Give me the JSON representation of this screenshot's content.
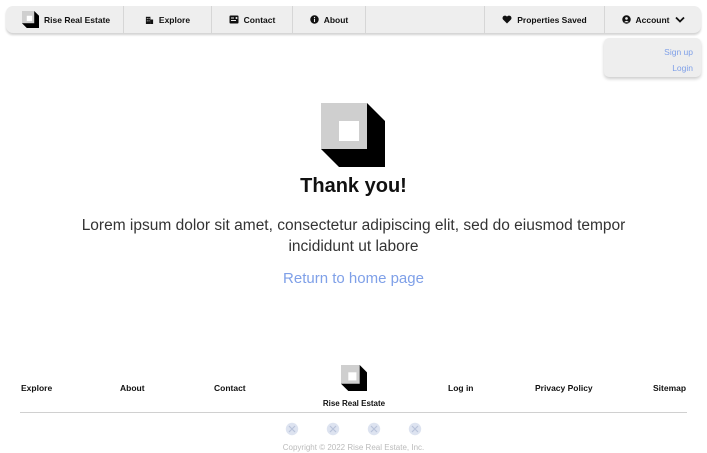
{
  "nav": {
    "brand": "Rise Real Estate",
    "explore": "Explore",
    "contact": "Contact",
    "about": "About",
    "saved": "Properties Saved",
    "account": "Account"
  },
  "dropdown": {
    "signup": "Sign up",
    "login": "Login"
  },
  "main": {
    "title": "Thank you!",
    "description": "Lorem ipsum dolor sit amet, consectetur adipiscing elit, sed do eiusmod tempor incididunt ut labore",
    "home_link": "Return to home page"
  },
  "footer": {
    "explore": "Explore",
    "about": "About",
    "contact": "Contact",
    "brand": "Rise Real Estate",
    "login": "Log in",
    "privacy": "Privacy Policy",
    "sitemap": "Sitemap",
    "socials": [
      "social-icon",
      "social-icon",
      "social-icon",
      "social-icon"
    ],
    "copyright": "Copyright © 2022 Rise Real Estate, Inc."
  },
  "colors": {
    "accent": "#7fa0e8",
    "nav_bg": "#eeeeee",
    "text": "#111111",
    "muted": "#bbbbbb"
  }
}
